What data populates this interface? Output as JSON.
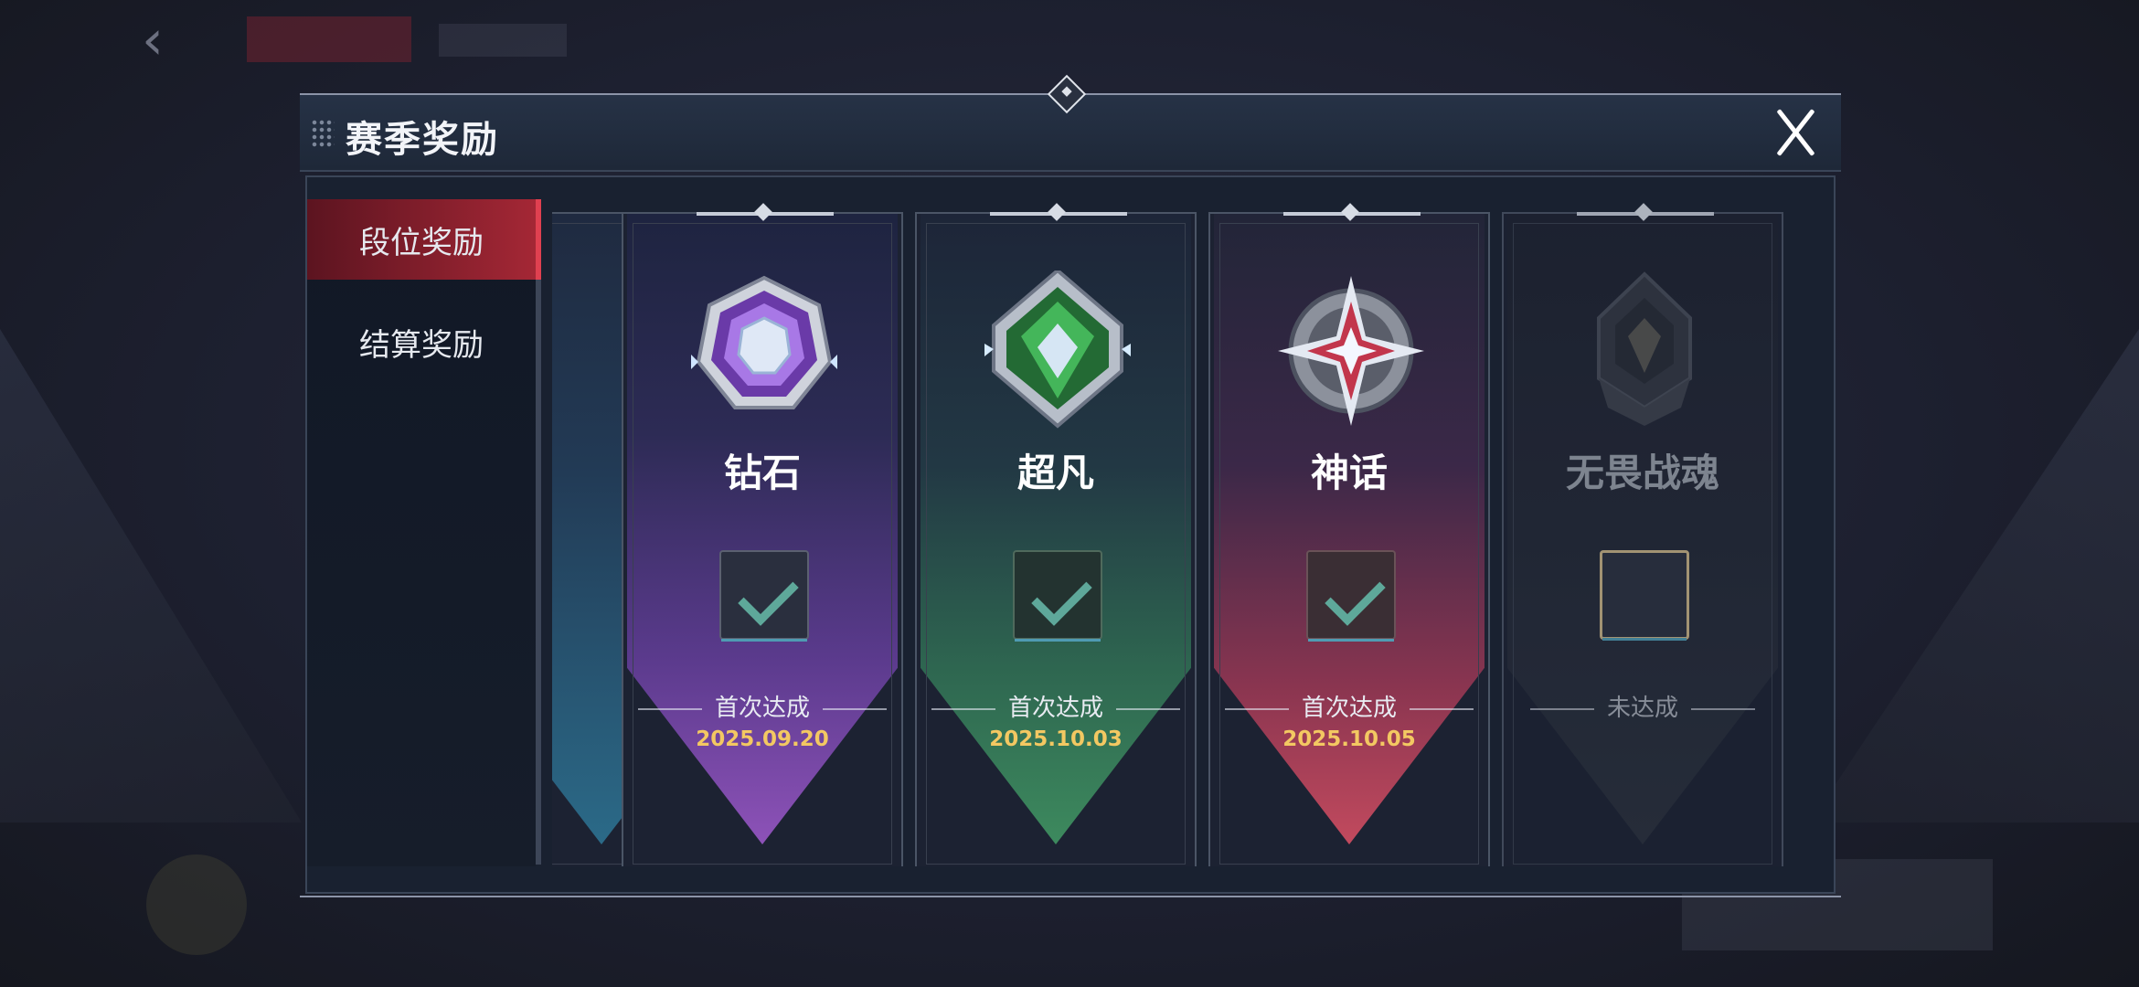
{
  "modal": {
    "title": "赛季奖励",
    "close_icon": "close-icon"
  },
  "sidebar": {
    "items": [
      {
        "label": "段位奖励",
        "active": true
      },
      {
        "label": "结算奖励",
        "active": false
      }
    ]
  },
  "ranks": [
    {
      "name": "钻石",
      "status": "首次达成",
      "date": "2025.09.20",
      "achieved": true,
      "color": "#8d52b8"
    },
    {
      "name": "超凡",
      "status": "首次达成",
      "date": "2025.10.03",
      "achieved": true,
      "color": "#3d8a5e"
    },
    {
      "name": "神话",
      "status": "首次达成",
      "date": "2025.10.05",
      "achieved": true,
      "color": "#c24a5e"
    },
    {
      "name": "无畏战魂",
      "status": "未达成",
      "date": "",
      "achieved": false,
      "color": "#2a303c"
    }
  ],
  "colors": {
    "accent_red": "#e04050",
    "date_gold": "#f3c862",
    "check_teal": "#5ea89a"
  }
}
